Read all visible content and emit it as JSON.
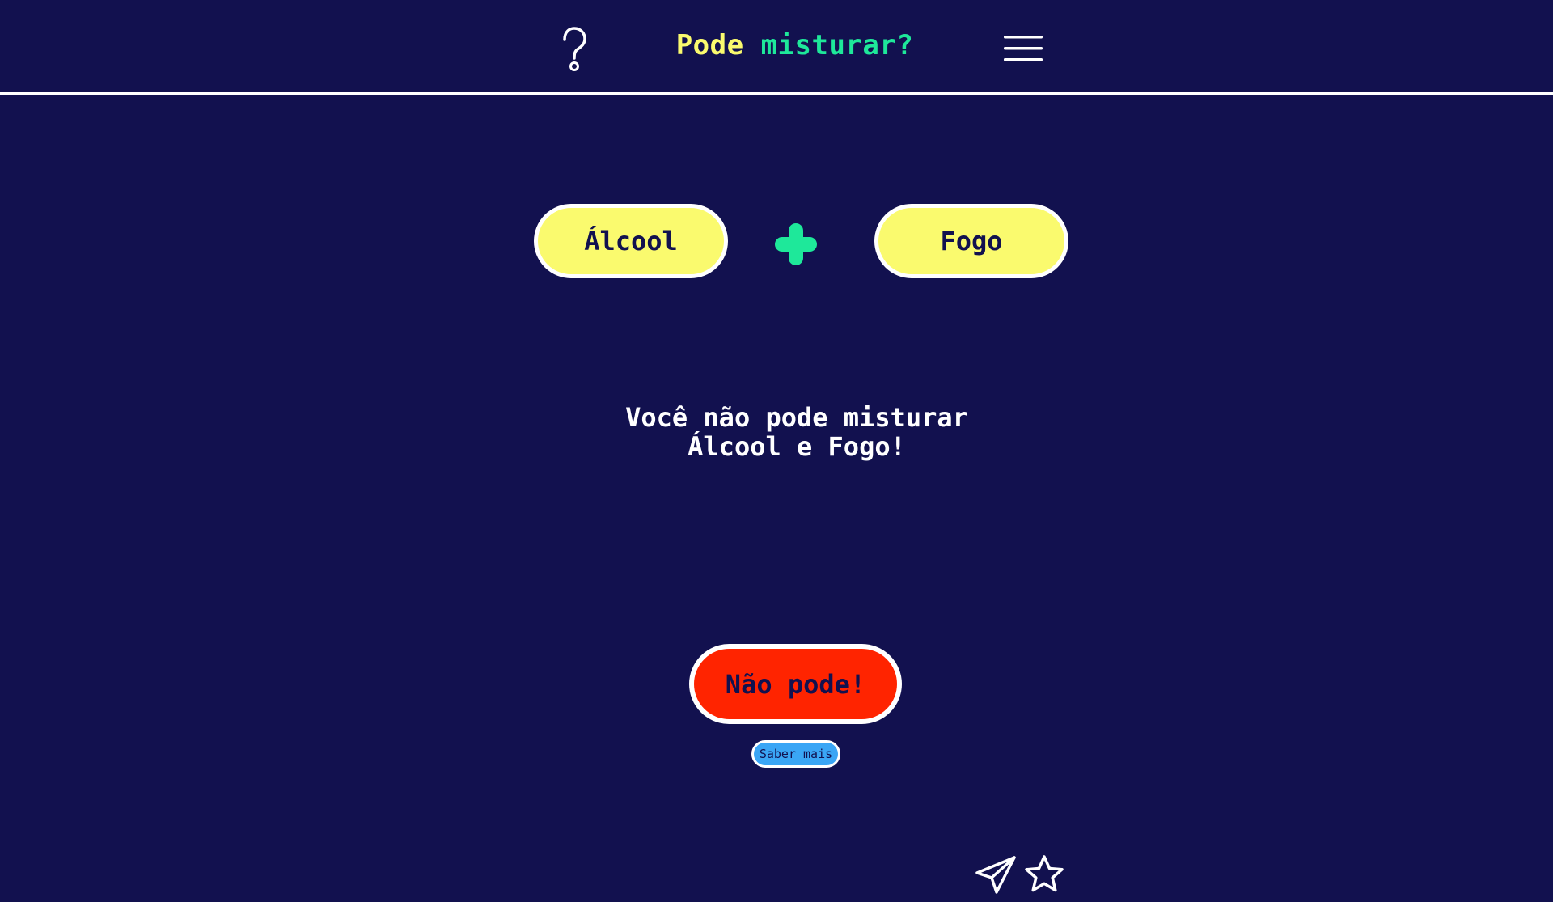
{
  "header": {
    "title_part1": "Pode",
    "title_part2": "misturar?",
    "help_icon": "question-mark-icon",
    "menu_icon": "hamburger-menu-icon"
  },
  "mix": {
    "left_item": "Álcool",
    "operator_icon": "plus-icon",
    "right_item": "Fogo"
  },
  "result": {
    "message_line1": "Você não pode misturar",
    "message_line2": "Álcool e Fogo!",
    "verdict_label": "Não pode!",
    "more_label": "Saber mais"
  },
  "footer": {
    "share_icon": "paper-plane-icon",
    "favorite_icon": "star-icon"
  },
  "colors": {
    "background": "#12114f",
    "title_part1": "#fafa6e",
    "title_part2": "#1ee89a",
    "pill": "#fafa6e",
    "plus": "#1ee89a",
    "verdict": "#ff2400",
    "more": "#3aa6f5"
  }
}
